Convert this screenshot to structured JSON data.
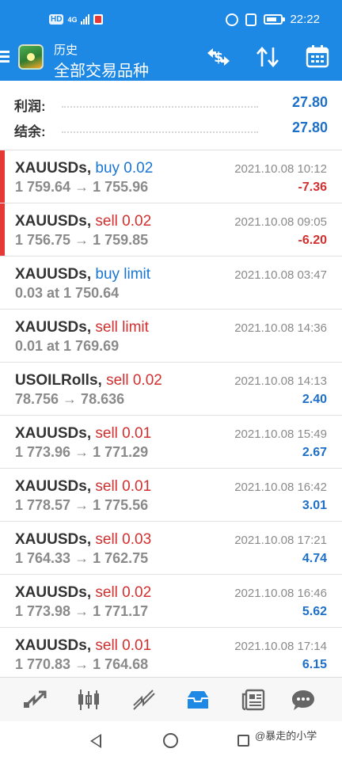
{
  "status_bar": {
    "left_chip": "HD",
    "network": "4G",
    "time": "22:22"
  },
  "header": {
    "subtitle": "历史",
    "title": "全部交易品种",
    "icons": [
      "menu-icon",
      "app-logo",
      "currency-exchange-icon",
      "sort-icon",
      "calendar-icon"
    ]
  },
  "summary": {
    "profit_label": "利润:",
    "profit_value": "27.80",
    "balance_label": "结余:",
    "balance_value": "27.80"
  },
  "trades": [
    {
      "symbol": "XAUUSDs",
      "type": "buy 0.02",
      "side": "buy",
      "prices": "1 759.64 → 1 755.96",
      "time": "2021.10.08 10:12",
      "profit": "-7.36",
      "marked": true
    },
    {
      "symbol": "XAUUSDs",
      "type": "sell 0.02",
      "side": "sell",
      "prices": "1 756.75 → 1 759.85",
      "time": "2021.10.08 09:05",
      "profit": "-6.20",
      "marked": true
    },
    {
      "symbol": "XAUUSDs",
      "type": "buy limit",
      "side": "buy",
      "prices": "0.03 at 1 750.64",
      "time": "2021.10.08 03:47",
      "profit": "",
      "marked": false
    },
    {
      "symbol": "XAUUSDs",
      "type": "sell limit",
      "side": "sell",
      "prices": "0.01 at 1 769.69",
      "time": "2021.10.08 14:36",
      "profit": "",
      "marked": false
    },
    {
      "symbol": "USOILRolls",
      "type": "sell 0.02",
      "side": "sell",
      "prices": "78.756 → 78.636",
      "time": "2021.10.08 14:13",
      "profit": "2.40",
      "marked": false
    },
    {
      "symbol": "XAUUSDs",
      "type": "sell 0.01",
      "side": "sell",
      "prices": "1 773.96 → 1 771.29",
      "time": "2021.10.08 15:49",
      "profit": "2.67",
      "marked": false
    },
    {
      "symbol": "XAUUSDs",
      "type": "sell 0.01",
      "side": "sell",
      "prices": "1 778.57 → 1 775.56",
      "time": "2021.10.08 16:42",
      "profit": "3.01",
      "marked": false
    },
    {
      "symbol": "XAUUSDs",
      "type": "sell 0.03",
      "side": "sell",
      "prices": "1 764.33 → 1 762.75",
      "time": "2021.10.08 17:21",
      "profit": "4.74",
      "marked": false
    },
    {
      "symbol": "XAUUSDs",
      "type": "sell 0.02",
      "side": "sell",
      "prices": "1 773.98 → 1 771.17",
      "time": "2021.10.08 16:46",
      "profit": "5.62",
      "marked": false
    },
    {
      "symbol": "XAUUSDs",
      "type": "sell 0.01",
      "side": "sell",
      "prices": "1 770.83 → 1 764.68",
      "time": "2021.10.08 17:14",
      "profit": "6.15",
      "marked": false
    }
  ],
  "bottom_tabs": [
    "quotes-icon",
    "chart-icon",
    "trade-icon",
    "history-icon",
    "news-icon",
    "messages-icon"
  ],
  "active_tab": "history-icon",
  "watermark": "@暴走的小学",
  "colors": {
    "header_bg": "#1e88e5",
    "buy": "#1976d2",
    "sell": "#d32f2f",
    "profit_positive": "#1e6fc8",
    "profit_negative": "#d32f2f",
    "row_marker": "#e53935"
  }
}
